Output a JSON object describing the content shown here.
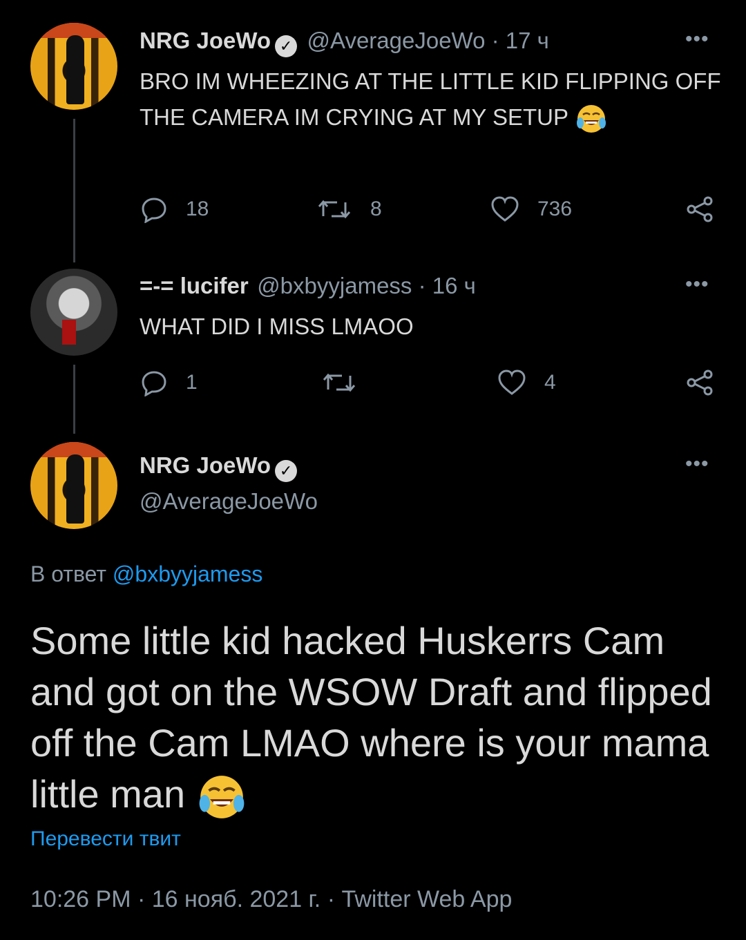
{
  "tweet1": {
    "name": "NRG JoeWo",
    "handle": "@AverageJoeWo",
    "time": " · 17 ч",
    "text": "BRO IM WHEEZING AT THE LITTLE KID FLIPPING OFF THE CAMERA IM CRYING AT MY SETUP",
    "emoji": "face-with-tears-of-joy",
    "replies": "18",
    "retweets": "8",
    "likes": "736"
  },
  "tweet2": {
    "name": "=-= lucifer",
    "handle": "@bxbyyjamess",
    "time": " · 16 ч",
    "text": "WHAT DID I MISS LMAOO",
    "replies": "1",
    "retweets": "",
    "likes": "4"
  },
  "main_tweet": {
    "name": "NRG JoeWo",
    "handle": "@AverageJoeWo",
    "reply_prefix": "В ответ ",
    "reply_mention": "@bxbyyjamess",
    "text": "Some little kid hacked Huskerrs Cam and got on the WSOW Draft and flipped off the Cam LMAO where is your mama little man",
    "emoji": "face-with-tears-of-joy",
    "translate_label": "Перевести твит",
    "timestamp": "10:26 PM · 16 нояб. 2021 г. · Twitter Web App"
  },
  "colors": {
    "background": "#000000",
    "text": "#d9d9d9",
    "secondary": "#8b98a5",
    "link": "#1d9bf0"
  }
}
